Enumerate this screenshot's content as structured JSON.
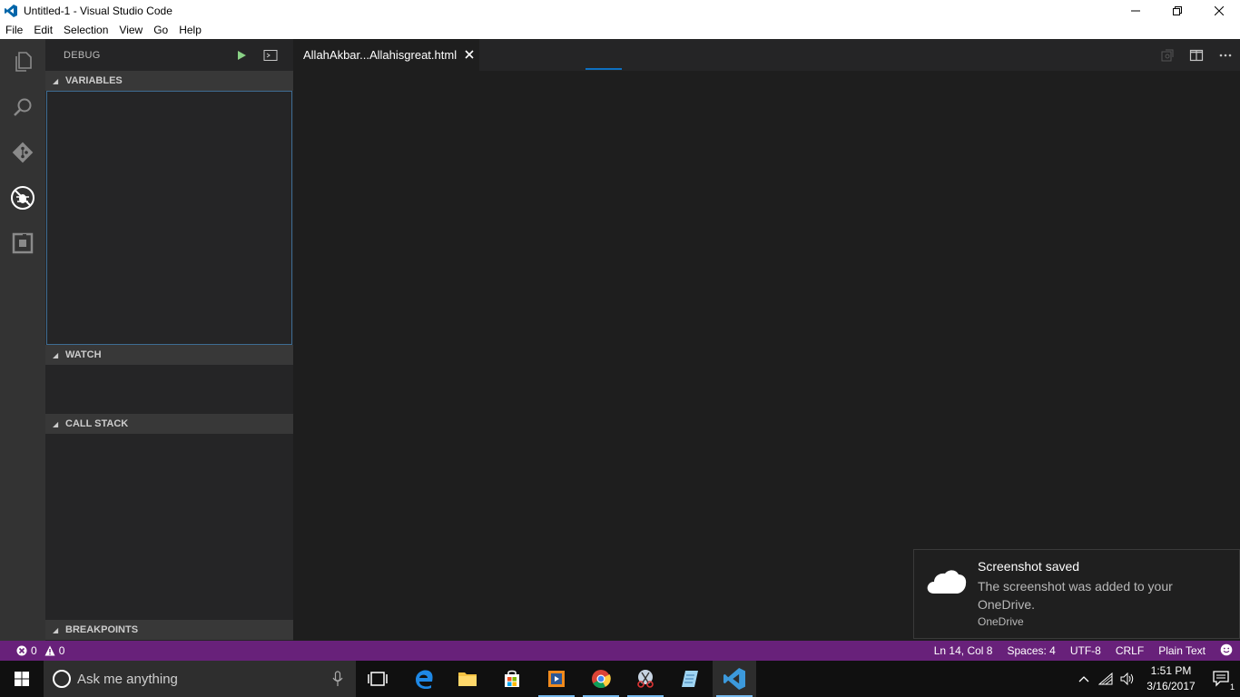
{
  "window": {
    "title": "Untitled-1 - Visual Studio Code",
    "controls": [
      "minimize-icon",
      "restore-icon",
      "close-icon"
    ]
  },
  "menu": [
    "File",
    "Edit",
    "Selection",
    "View",
    "Go",
    "Help"
  ],
  "activity_bar": [
    "explorer-icon",
    "search-icon",
    "git-icon",
    "debug-icon",
    "extensions-icon"
  ],
  "sidebar": {
    "title": "DEBUG",
    "sections": {
      "variables": "VARIABLES",
      "watch": "WATCH",
      "call_stack": "CALL STACK",
      "breakpoints": "BREAKPOINTS"
    }
  },
  "editor": {
    "tab_label": "AllahAkbar...Allahisgreat.html"
  },
  "notification": {
    "title": "Screenshot saved",
    "body": "The screenshot was added to your OneDrive.",
    "source": "OneDrive"
  },
  "status": {
    "errors": "0",
    "warnings": "0",
    "position": "Ln 14, Col 8",
    "indent": "Spaces: 4",
    "encoding": "UTF-8",
    "eol": "CRLF",
    "language": "Plain Text"
  },
  "taskbar": {
    "search_placeholder": "Ask me anything",
    "time": "1:51 PM",
    "date": "3/16/2017",
    "notification_count": "1"
  },
  "colors": {
    "statusbar": "#68217a",
    "activitybar": "#333333",
    "sidebar": "#252526",
    "editor": "#1e1e1e",
    "accent": "#0e70c0"
  }
}
